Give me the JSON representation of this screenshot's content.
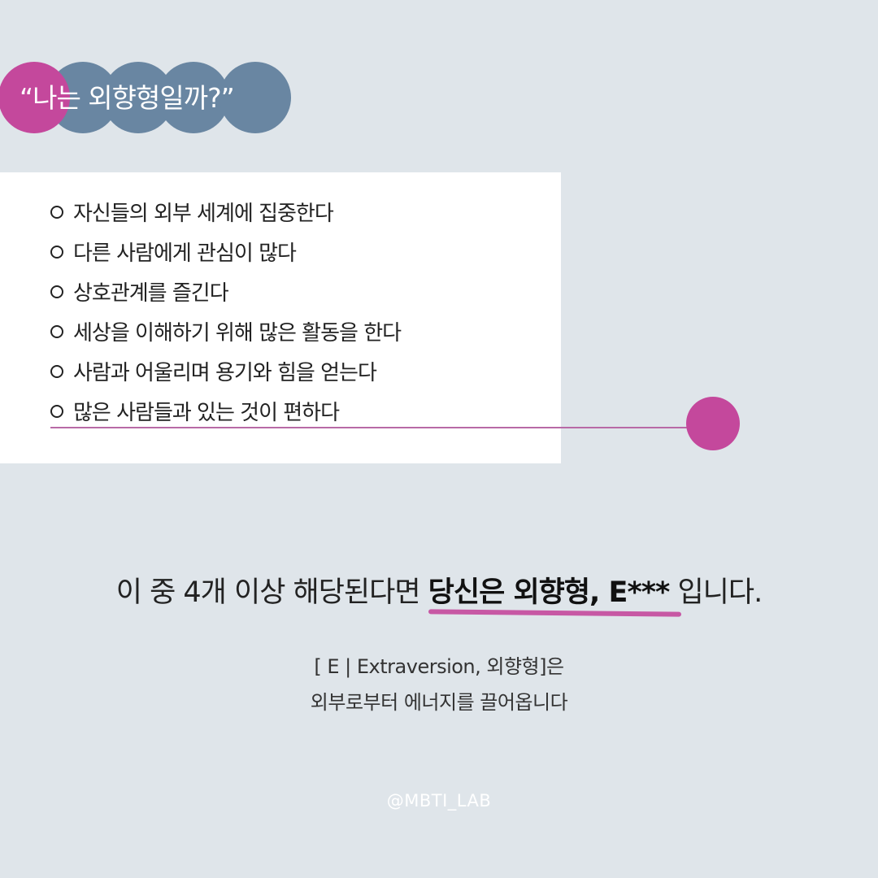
{
  "title": "“나는 외향형일까?”",
  "checklist": [
    "자신들의 외부 세계에 집중한다",
    "다른 사람에게 관심이 많다",
    "상호관계를 즐긴다",
    "세상을 이해하기 위해 많은 활동을 한다",
    "사람과 어울리며 용기와 힘을 얻는다",
    "많은 사람들과 있는 것이 편하다"
  ],
  "summary": {
    "prefix": "이 중 4개 이상 해당된다면 ",
    "highlight": "당신은 외향형, E***",
    "suffix": " 입니다."
  },
  "description": {
    "line1": "[ E | Extraversion, 외향형]은",
    "line2": "외부로부터 에너지를 끌어옵니다"
  },
  "handle": "@MBTI_LAB",
  "colors": {
    "background": "#dfe5ea",
    "accent_pink": "#c4489c",
    "accent_blue": "#6986a2"
  }
}
